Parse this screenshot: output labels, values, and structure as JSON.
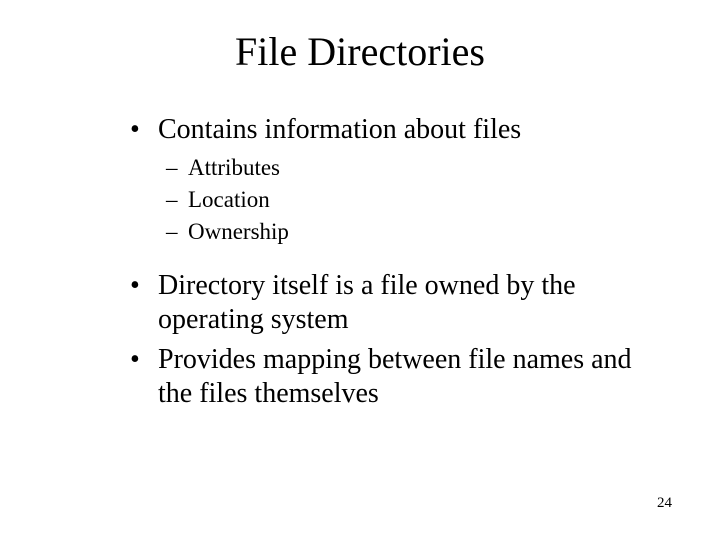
{
  "title": "File Directories",
  "bullets": {
    "b0": {
      "text": "Contains information about files",
      "subs": {
        "s0": "Attributes",
        "s1": "Location",
        "s2": "Ownership"
      }
    },
    "b1": {
      "text": "Directory itself is a file owned by the operating system"
    },
    "b2": {
      "text": "Provides mapping between file names and the files themselves"
    }
  },
  "page_number": "24",
  "markers": {
    "bullet": "•",
    "dash": "–"
  }
}
